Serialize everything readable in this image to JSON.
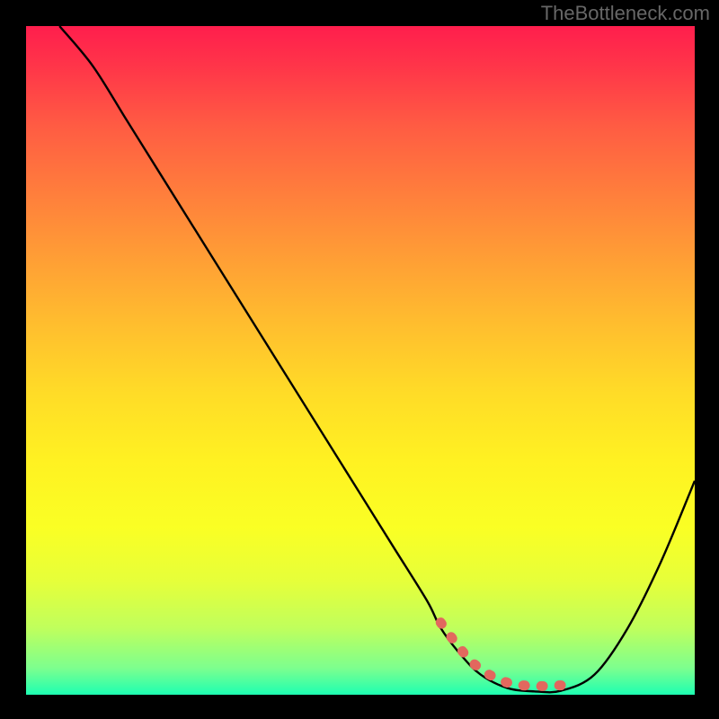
{
  "attribution": "TheBottleneck.com",
  "chart_data": {
    "type": "line",
    "title": "",
    "xlabel": "",
    "ylabel": "",
    "xlim": [
      0,
      100
    ],
    "ylim": [
      0,
      100
    ],
    "series": [
      {
        "name": "curve",
        "x": [
          5,
          10,
          15,
          20,
          25,
          30,
          35,
          40,
          45,
          50,
          55,
          60,
          62,
          65,
          68,
          72,
          76,
          80,
          85,
          90,
          95,
          100
        ],
        "values": [
          100,
          94,
          86,
          78,
          70,
          62,
          54,
          46,
          38,
          30,
          22,
          14,
          10,
          6,
          3,
          1,
          0.5,
          0.6,
          3,
          10,
          20,
          32
        ]
      }
    ],
    "marker_region": {
      "x_start": 62,
      "x_end": 80
    },
    "colors": {
      "background_top": "#ff1e4d",
      "background_bottom": "#1dffb2",
      "curve": "#000000",
      "marker": "#e2685e",
      "frame": "#000000"
    }
  }
}
